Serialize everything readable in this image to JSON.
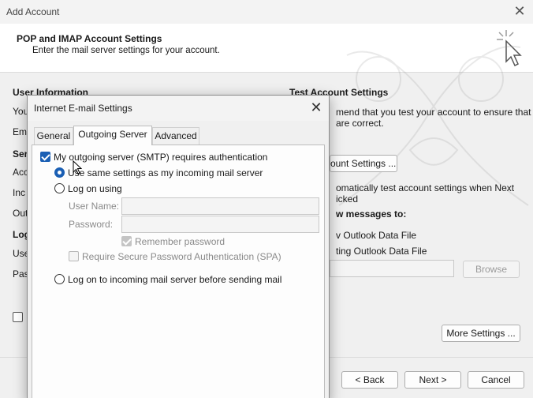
{
  "window": {
    "title": "Add Account",
    "header_title": "POP and IMAP Account Settings",
    "header_subtitle": "Enter the mail server settings for your account."
  },
  "left_panel": {
    "user_info_title": "User Information",
    "you_label": "You",
    "ema_label": "Ema",
    "serv_label": "Serv",
    "acc_label": "Acc",
    "inc_label": "Inc",
    "out_label": "Out",
    "log_title": "Log",
    "use_label": "Use",
    "pas_label": "Pas"
  },
  "right_panel": {
    "test_title": "Test Account Settings",
    "test_line1": "mend that you test your account to ensure that",
    "test_line2": "are correct.",
    "test_button": "ount Settings ...",
    "auto_line1": "omatically test account settings when Next",
    "auto_line2": "icked",
    "deliver_title": "w messages to:",
    "new_data_file": "v Outlook Data File",
    "existing_data_file": "ting Outlook Data File",
    "browse_button": "Browse",
    "more_settings_button": "More Settings ..."
  },
  "footer": {
    "back_button": "< Back",
    "next_button": "Next >",
    "cancel_button": "Cancel"
  },
  "dialog": {
    "title": "Internet E-mail Settings",
    "tabs": [
      {
        "label": "General"
      },
      {
        "label": "Outgoing Server"
      },
      {
        "label": "Advanced"
      }
    ],
    "requires_auth_label": "My outgoing server (SMTP) requires authentication",
    "requires_auth_checked": true,
    "use_same_settings_label": "Use same settings as my incoming mail server",
    "log_on_using_label": "Log on using",
    "user_name_label": "User Name:",
    "user_name_value": "",
    "password_label": "Password:",
    "password_value": "",
    "remember_password_label": "Remember password",
    "spa_label": "Require Secure Password Authentication (SPA)",
    "log_on_incoming_label": "Log on to incoming mail server before sending mail",
    "selected_option": "use_same_settings"
  },
  "colors": {
    "accent": "#1a5fb4",
    "window_bg": "#f0f0f0",
    "header_bg": "#ffffff"
  }
}
